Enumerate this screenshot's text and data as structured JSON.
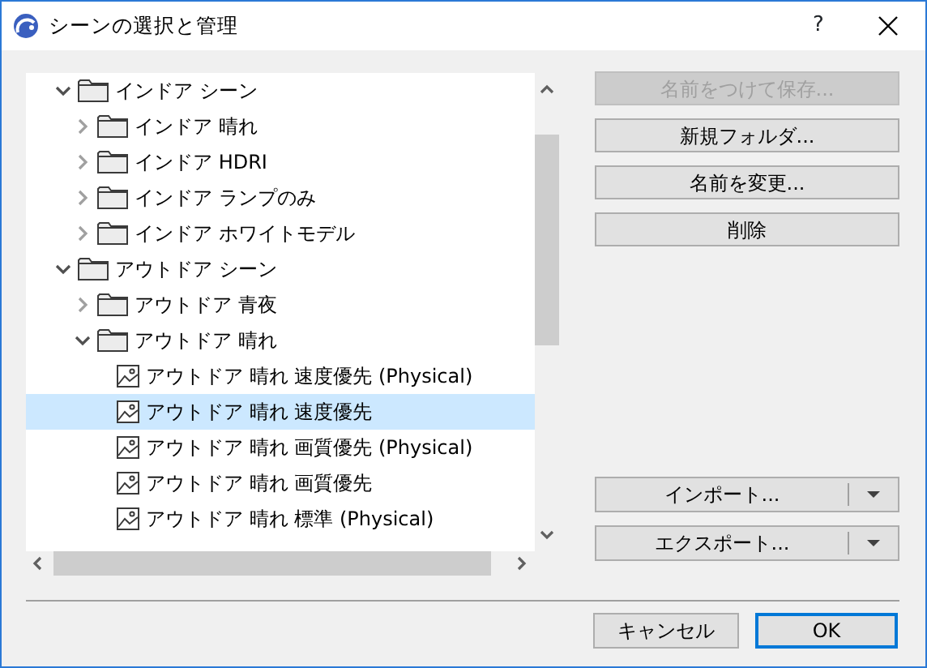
{
  "window": {
    "title": "シーンの選択と管理",
    "help": "?"
  },
  "tree": [
    {
      "kind": "folder",
      "label": "インドア シーン",
      "expanded": true,
      "selected": false,
      "children": [
        {
          "kind": "folder",
          "label": "インドア 晴れ",
          "expanded": false,
          "selected": false
        },
        {
          "kind": "folder",
          "label": "インドア HDRI",
          "expanded": false,
          "selected": false
        },
        {
          "kind": "folder",
          "label": "インドア ランプのみ",
          "expanded": false,
          "selected": false
        },
        {
          "kind": "folder",
          "label": "インドア ホワイトモデル",
          "expanded": false,
          "selected": false
        }
      ]
    },
    {
      "kind": "folder",
      "label": "アウトドア シーン",
      "expanded": true,
      "selected": false,
      "children": [
        {
          "kind": "folder",
          "label": "アウトドア 青夜",
          "expanded": false,
          "selected": false
        },
        {
          "kind": "folder",
          "label": "アウトドア 晴れ",
          "expanded": true,
          "selected": false,
          "children": [
            {
              "kind": "scene",
              "label": "アウトドア 晴れ 速度優先 (Physical)",
              "selected": false
            },
            {
              "kind": "scene",
              "label": "アウトドア 晴れ 速度優先",
              "selected": true
            },
            {
              "kind": "scene",
              "label": "アウトドア 晴れ 画質優先 (Physical)",
              "selected": false
            },
            {
              "kind": "scene",
              "label": "アウトドア 晴れ 画質優先",
              "selected": false
            },
            {
              "kind": "scene",
              "label": "アウトドア 晴れ 標準 (Physical)",
              "selected": false
            }
          ]
        }
      ]
    }
  ],
  "actions": [
    {
      "label": "名前をつけて保存...",
      "disabled": true
    },
    {
      "label": "新規フォルダ...",
      "disabled": false
    },
    {
      "label": "名前を変更...",
      "disabled": false
    },
    {
      "label": "削除",
      "disabled": false
    }
  ],
  "split_buttons": [
    {
      "label": "インポート..."
    },
    {
      "label": "エクスポート..."
    }
  ],
  "footer": [
    {
      "label": "キャンセル",
      "default": false
    },
    {
      "label": "OK",
      "default": true
    }
  ]
}
